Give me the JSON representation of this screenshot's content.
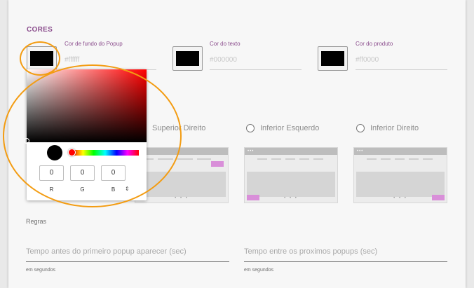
{
  "section_title": "CORES",
  "colors": [
    {
      "label": "Cor de fundo do Popup",
      "value": "#ffffff",
      "swatch": "#000000"
    },
    {
      "label": "Cor do texto",
      "value": "#000000",
      "swatch": "#000000"
    },
    {
      "label": "Cor do produto",
      "value": "#ff0000",
      "swatch": "#000000"
    }
  ],
  "positions": [
    {
      "label": "Superior Direito"
    },
    {
      "label": "Inferior Esquerdo"
    },
    {
      "label": "Inferior Direito"
    }
  ],
  "picker": {
    "r": "0",
    "g": "0",
    "b": "0",
    "r_label": "R",
    "g_label": "G",
    "b_label": "B",
    "spin_glyph": "⇕"
  },
  "rules": {
    "label": "Regras",
    "first_popup_placeholder": "Tempo antes do primeiro popup aparecer (sec)",
    "between_popups_placeholder": "Tempo entre os proximos popups (sec)",
    "hint": "em segundos"
  },
  "accent": "#8a4c8c",
  "annotation_color": "#f39c12"
}
